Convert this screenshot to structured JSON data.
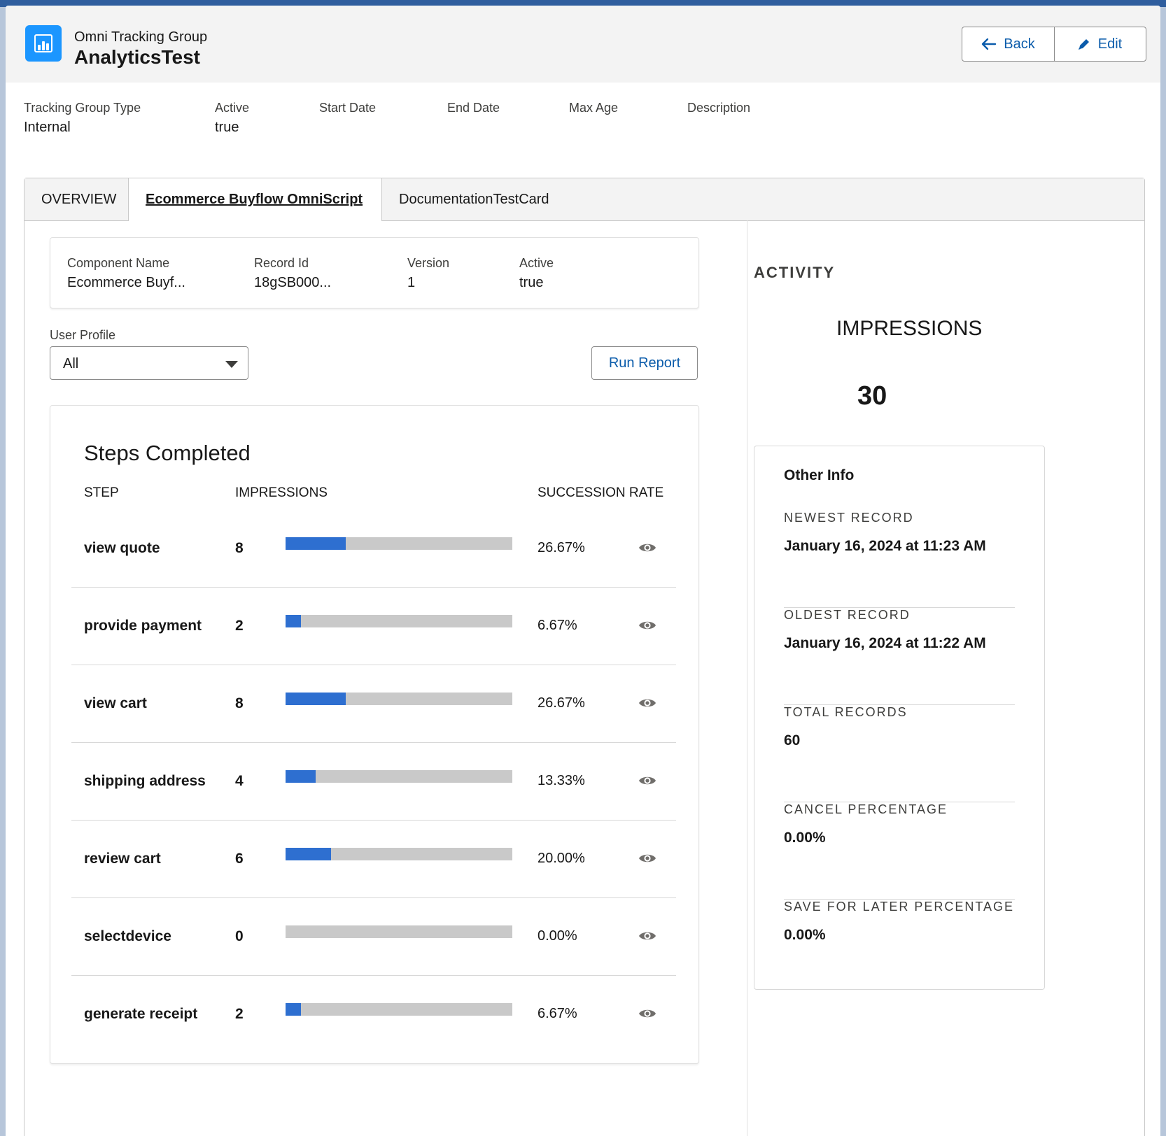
{
  "header": {
    "object_label": "Omni Tracking Group",
    "record_title": "AnalyticsTest",
    "buttons": {
      "back": "Back",
      "edit": "Edit"
    }
  },
  "fields": [
    {
      "label": "Tracking Group Type",
      "value": "Internal"
    },
    {
      "label": "Active",
      "value": "true"
    },
    {
      "label": "Start Date",
      "value": ""
    },
    {
      "label": "End Date",
      "value": ""
    },
    {
      "label": "Max Age",
      "value": ""
    },
    {
      "label": "Description",
      "value": ""
    }
  ],
  "tabs": [
    {
      "label": "OVERVIEW",
      "active": false
    },
    {
      "label": "Ecommerce Buyflow OmniScript",
      "active": true
    },
    {
      "label": "DocumentationTestCard",
      "active": false
    }
  ],
  "component": {
    "fields": [
      {
        "label": "Component Name",
        "value": "Ecommerce Buyf..."
      },
      {
        "label": "Record Id",
        "value": "18gSB000..."
      },
      {
        "label": "Version",
        "value": "1"
      },
      {
        "label": "Active",
        "value": "true"
      }
    ]
  },
  "filter": {
    "user_profile_label": "User Profile",
    "user_profile_value": "All",
    "run_report": "Run Report"
  },
  "steps": {
    "title": "Steps Completed",
    "columns": {
      "step": "STEP",
      "impressions": "IMPRESSIONS",
      "rate": "SUCCESSION RATE"
    },
    "rows": [
      {
        "step": "view quote",
        "impressions": "8",
        "rate": "26.67%",
        "fraction": 0.2667
      },
      {
        "step": "provide payment",
        "impressions": "2",
        "rate": "6.67%",
        "fraction": 0.0667
      },
      {
        "step": "view cart",
        "impressions": "8",
        "rate": "26.67%",
        "fraction": 0.2667
      },
      {
        "step": "shipping address",
        "impressions": "4",
        "rate": "13.33%",
        "fraction": 0.1333
      },
      {
        "step": "review cart",
        "impressions": "6",
        "rate": "20.00%",
        "fraction": 0.2
      },
      {
        "step": "selectdevice",
        "impressions": "0",
        "rate": "0.00%",
        "fraction": 0
      },
      {
        "step": "generate receipt",
        "impressions": "2",
        "rate": "6.67%",
        "fraction": 0.0667
      }
    ]
  },
  "activity": {
    "heading": "ACTIVITY",
    "impressions_label": "IMPRESSIONS",
    "impressions_value": "30"
  },
  "other_info": {
    "title": "Other Info",
    "items": [
      {
        "label": "NEWEST RECORD",
        "value": "January 16, 2024 at 11:23 AM"
      },
      {
        "label": "OLDEST RECORD",
        "value": "January 16, 2024 at 11:22 AM"
      },
      {
        "label": "TOTAL RECORDS",
        "value": "60"
      },
      {
        "label": "CANCEL PERCENTAGE",
        "value": "0.00%"
      },
      {
        "label": "SAVE FOR LATER PERCENTAGE",
        "value": "0.00%"
      }
    ]
  },
  "colors": {
    "brand": "#1b96ff",
    "bar_fill": "#2e6fd0",
    "bar_track": "#c9c9c9",
    "link": "#0b5cab"
  },
  "icons": {
    "app": "chart-icon",
    "back": "arrow-left-icon",
    "edit": "pencil-icon",
    "row_action": "eye-icon",
    "dropdown": "caret-down-icon"
  }
}
